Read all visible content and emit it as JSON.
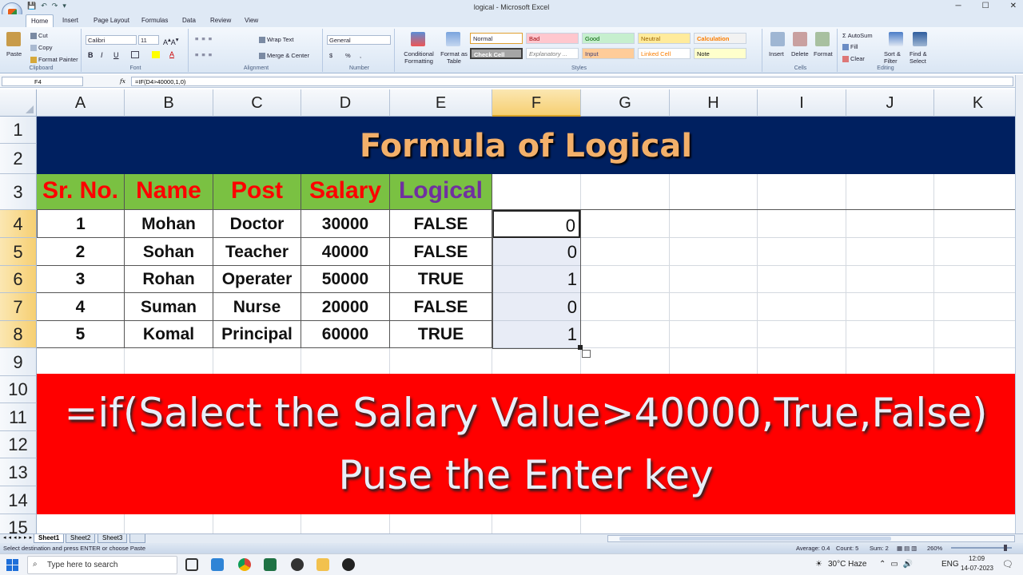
{
  "window": {
    "title": "logical - Microsoft Excel",
    "minimize": "─",
    "maximize": "☐",
    "close": "✕"
  },
  "tabs": [
    "Home",
    "Insert",
    "Page Layout",
    "Formulas",
    "Data",
    "Review",
    "View"
  ],
  "ribbon": {
    "clipboard": {
      "paste": "Paste",
      "cut": "Cut",
      "copy": "Copy",
      "format_painter": "Format Painter",
      "label": "Clipboard"
    },
    "font": {
      "name": "Calibri",
      "size": "11",
      "label": "Font",
      "bold": "B",
      "italic": "I",
      "underline": "U"
    },
    "alignment": {
      "wrap": "Wrap Text",
      "merge": "Merge & Center",
      "label": "Alignment"
    },
    "number": {
      "format": "General",
      "label": "Number",
      "currency": "$",
      "percent": "%",
      "comma": ","
    },
    "styles": {
      "conditional": "Conditional Formatting",
      "format_table": "Format as Table",
      "normal": "Normal",
      "bad": "Bad",
      "good": "Good",
      "neutral": "Neutral",
      "calculation": "Calculation",
      "check_cell": "Check Cell",
      "explanatory": "Explanatory ...",
      "input": "Input",
      "linked_cell": "Linked Cell",
      "note": "Note",
      "label": "Styles"
    },
    "cells": {
      "insert": "Insert",
      "delete": "Delete",
      "format": "Format",
      "label": "Cells"
    },
    "editing": {
      "autosum": "AutoSum",
      "fill": "Fill",
      "clear": "Clear",
      "sort": "Sort & Filter",
      "find": "Find & Select",
      "label": "Editing"
    }
  },
  "formula_bar": {
    "name_box": "F4",
    "fx": "fx",
    "formula": "=IF(D4>40000,1,0)"
  },
  "columns": [
    "A",
    "B",
    "C",
    "D",
    "E",
    "F",
    "G",
    "H",
    "I",
    "J",
    "K"
  ],
  "rows": [
    "1",
    "2",
    "3",
    "4",
    "5",
    "6",
    "7",
    "8",
    "9",
    "10",
    "11",
    "12",
    "13",
    "14",
    "15"
  ],
  "banner_title": "Formula  of Logical",
  "table": {
    "headers": [
      "Sr. No.",
      "Name",
      "Post",
      "Salary",
      "Logical"
    ],
    "header_colors": [
      "#ff0000",
      "#ff0000",
      "#ff0000",
      "#ff0000",
      "#7030a0"
    ],
    "rows": [
      [
        "1",
        "Mohan",
        "Doctor",
        "30000",
        "FALSE",
        "0"
      ],
      [
        "2",
        "Sohan",
        "Teacher",
        "40000",
        "FALSE",
        "0"
      ],
      [
        "3",
        "Rohan",
        "Operater",
        "50000",
        "TRUE",
        "1"
      ],
      [
        "4",
        "Suman",
        "Nurse",
        "20000",
        "FALSE",
        "0"
      ],
      [
        "5",
        "Komal",
        "Principal",
        "60000",
        "TRUE",
        "1"
      ]
    ]
  },
  "instruction": {
    "line1": "=if(Salect the Salary Value>40000,True,False)",
    "line2": "Puse the Enter key"
  },
  "sheets": [
    "Sheet1",
    "Sheet2",
    "Sheet3"
  ],
  "status": {
    "message": "Select destination and press ENTER or choose Paste",
    "average": "Average: 0.4",
    "count": "Count: 5",
    "sum": "Sum: 2",
    "zoom": "260%"
  },
  "taskbar": {
    "search_placeholder": "Type here to search",
    "weather": "30°C  Haze",
    "lang": "ENG",
    "time": "12:09",
    "date": "14-07-2023"
  }
}
